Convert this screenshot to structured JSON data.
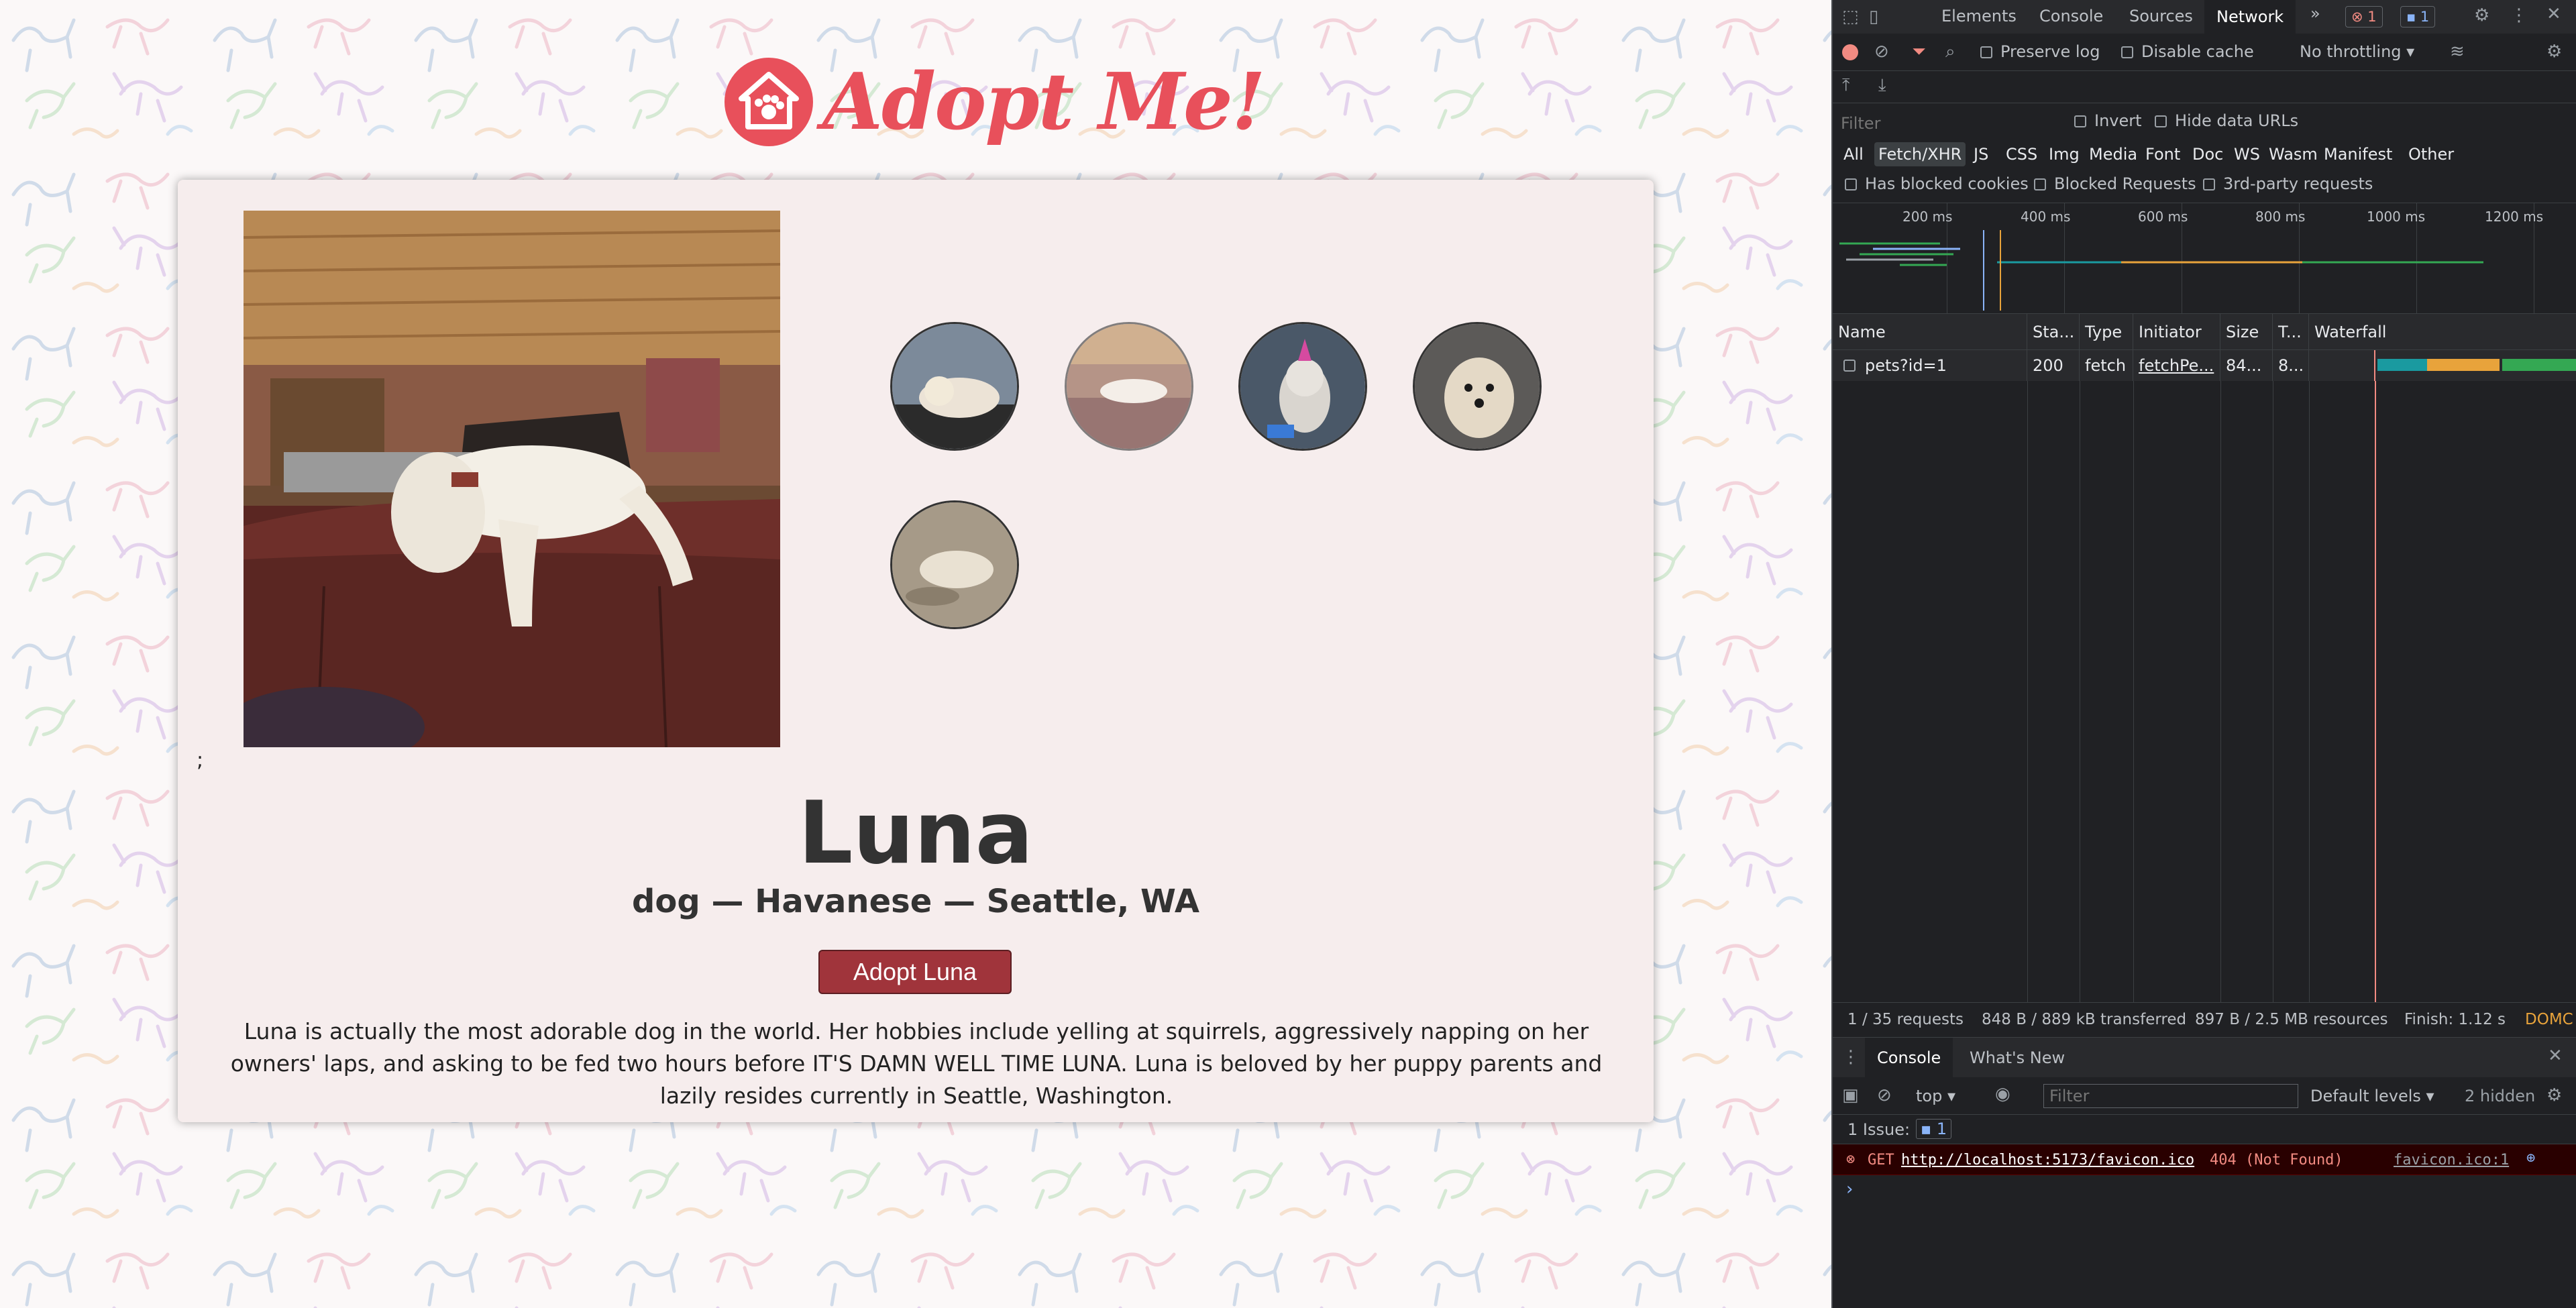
{
  "app": {
    "logo_text": "Adopt Me!",
    "logo_icon": "paw-house-icon",
    "brand_color": "#e8505b"
  },
  "pet": {
    "stray_text": ";",
    "name": "Luna",
    "subtitle": "dog — Havanese — Seattle, WA",
    "adopt_label": "Adopt Luna",
    "description": "Luna is actually the most adorable dog in the world. Her hobbies include yelling at squirrels, aggressively napping on her owners' laps, and asking to be fed two hours before IT'S DAMN WELL TIME LUNA. Luna is beloved by her puppy parents and lazily resides currently in Seattle, Washington.",
    "thumbnails": [
      "dog-lying-photo",
      "dog-on-couch-photo",
      "dog-party-hat-photo",
      "dog-portrait-photo",
      "dog-on-floor-photo"
    ],
    "active_thumbnail": 1
  },
  "devtools": {
    "tabs": [
      "Elements",
      "Console",
      "Sources",
      "Network"
    ],
    "active_tab": "Network",
    "more_tabs": "»",
    "error_count": "1",
    "message_count": "1",
    "preserve_log": "Preserve log",
    "disable_cache": "Disable cache",
    "throttling": "No throttling",
    "filter_placeholder": "Filter",
    "invert": "Invert",
    "hide_data_urls": "Hide data URLs",
    "types": [
      "All",
      "Fetch/XHR",
      "JS",
      "CSS",
      "Img",
      "Media",
      "Font",
      "Doc",
      "WS",
      "Wasm",
      "Manifest",
      "Other"
    ],
    "active_type": "Fetch/XHR",
    "has_blocked_cookies": "Has blocked cookies",
    "blocked_requests": "Blocked Requests",
    "third_party": "3rd-party requests",
    "timeline_ticks": [
      "200 ms",
      "400 ms",
      "600 ms",
      "800 ms",
      "1000 ms",
      "1200 ms"
    ],
    "columns": [
      "Name",
      "Sta...",
      "Type",
      "Initiator",
      "Size",
      "T...",
      "Waterfall"
    ],
    "requests": [
      {
        "name": "pets?id=1",
        "status": "200",
        "type": "fetch",
        "initiator": "fetchPe...",
        "size": "84...",
        "time": "8..."
      }
    ],
    "summary": {
      "requests": "1 / 35 requests",
      "transferred": "848 B / 889 kB transferred",
      "resources": "897 B / 2.5 MB resources",
      "finish": "Finish: 1.12 s",
      "domc": "DOMC"
    },
    "console": {
      "tabs": [
        "Console",
        "What's New"
      ],
      "context": "top",
      "filter_placeholder": "Filter",
      "levels": "Default levels",
      "hidden": "2 hidden",
      "issues_label": "1 Issue:",
      "issues_count": "1",
      "error": {
        "method": "GET",
        "url": "http://localhost:5173/favicon.ico",
        "status": "404 (Not Found)",
        "source": "favicon.ico:1"
      },
      "prompt": "›"
    },
    "colors": {
      "background": "#202124",
      "error": "#f28b82",
      "waterfall_waiting": "#1a9aa0",
      "waterfall_download": "#e8a33b",
      "waterfall_ready": "#34a853"
    }
  }
}
